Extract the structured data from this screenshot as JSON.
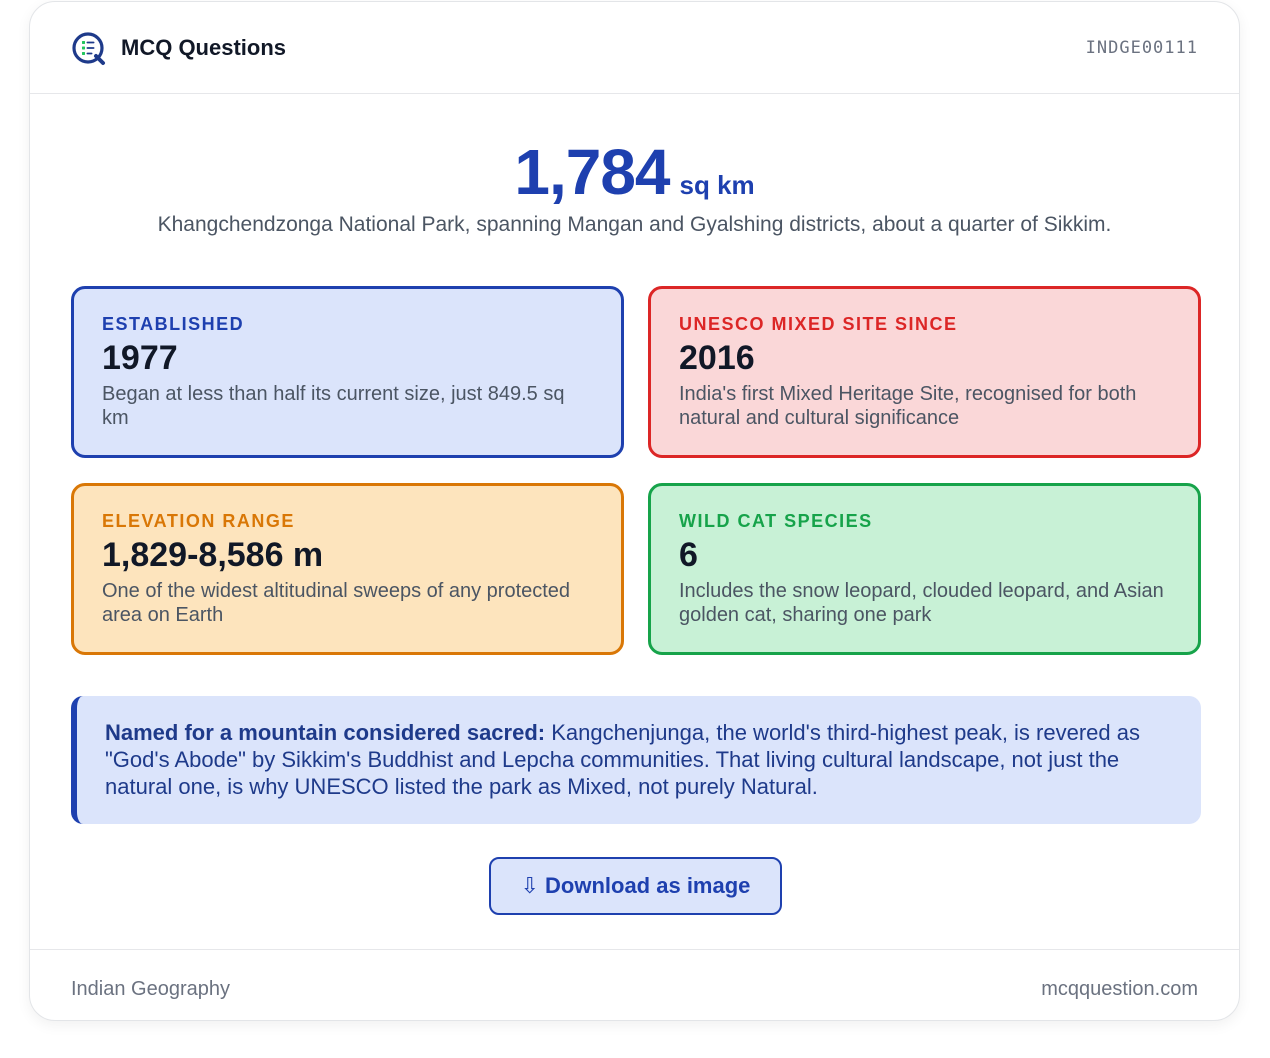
{
  "header": {
    "brand": "MCQ Questions",
    "code": "INDGE00111",
    "logo_icon": "mcq-logo-icon"
  },
  "hero": {
    "number": "1,784",
    "unit": "sq km",
    "subtitle": "Khangchendzonga National Park, spanning Mangan and Gyalshing districts, about a quarter of Sikkim."
  },
  "stats": [
    {
      "label": "ESTABLISHED",
      "value": "1977",
      "desc": "Began at less than half its current size, just 849.5 sq km",
      "color": "#1e40af"
    },
    {
      "label": "UNESCO MIXED SITE SINCE",
      "value": "2016",
      "desc": "India's first Mixed Heritage Site, recognised for both natural and cultural significance",
      "color": "#dc2626"
    },
    {
      "label": "ELEVATION RANGE",
      "value": "1,829-8,586 m",
      "desc": "One of the widest altitudinal sweeps of any protected area on Earth",
      "color": "#d97706"
    },
    {
      "label": "WILD CAT SPECIES",
      "value": "6",
      "desc": "Includes the snow leopard, clouded leopard, and Asian golden cat, sharing one park",
      "color": "#16a34a"
    }
  ],
  "note": {
    "title": "Named for a mountain considered sacred:",
    "body": " Kangchenjunga, the world's third-highest peak, is revered as \"God's Abode\" by Sikkim's Buddhist and Lepcha communities. That living cultural landscape, not just the natural one, is why UNESCO listed the park as Mixed, not purely Natural."
  },
  "download": {
    "icon": "⇩",
    "label": "Download as image"
  },
  "footer": {
    "category": "Indian Geography",
    "site": "mcqquestion.com"
  }
}
